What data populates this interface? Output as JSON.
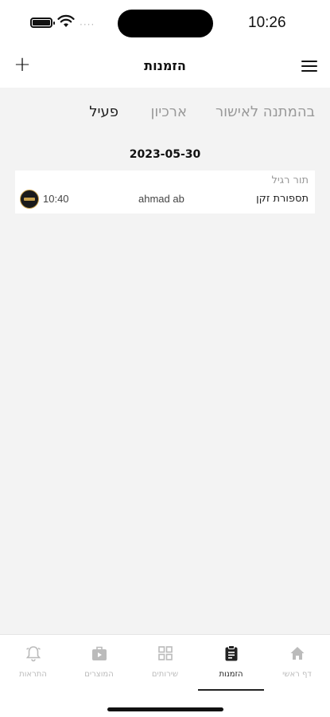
{
  "status_bar": {
    "time": "10:26",
    "signal_dots": "····"
  },
  "header": {
    "title": "הזמנות",
    "add_symbol": "+"
  },
  "tabs": [
    {
      "label": "בהמתנה לאישור",
      "active": false
    },
    {
      "label": "ארכיון",
      "active": false
    },
    {
      "label": "פעיל",
      "active": true
    }
  ],
  "date_heading": "2023-05-30",
  "booking": {
    "type": "תור רגיל",
    "service": "תספורת זקן",
    "customer": "ahmad ab",
    "time": "10:40"
  },
  "bottom_nav": [
    {
      "label": "התראות",
      "icon": "bell-icon",
      "active": false
    },
    {
      "label": "המוצרים",
      "icon": "shopping-bag-icon",
      "active": false
    },
    {
      "label": "שירותים",
      "icon": "grid-icon",
      "active": false
    },
    {
      "label": "הזמנות",
      "icon": "clipboard-icon",
      "active": true
    },
    {
      "label": "דף ראשי",
      "icon": "home-icon",
      "active": false
    }
  ],
  "colors": {
    "background": "#f3f3f3",
    "active_text": "#222222",
    "inactive_text": "#999999",
    "nav_inactive": "#bbbbbb"
  }
}
